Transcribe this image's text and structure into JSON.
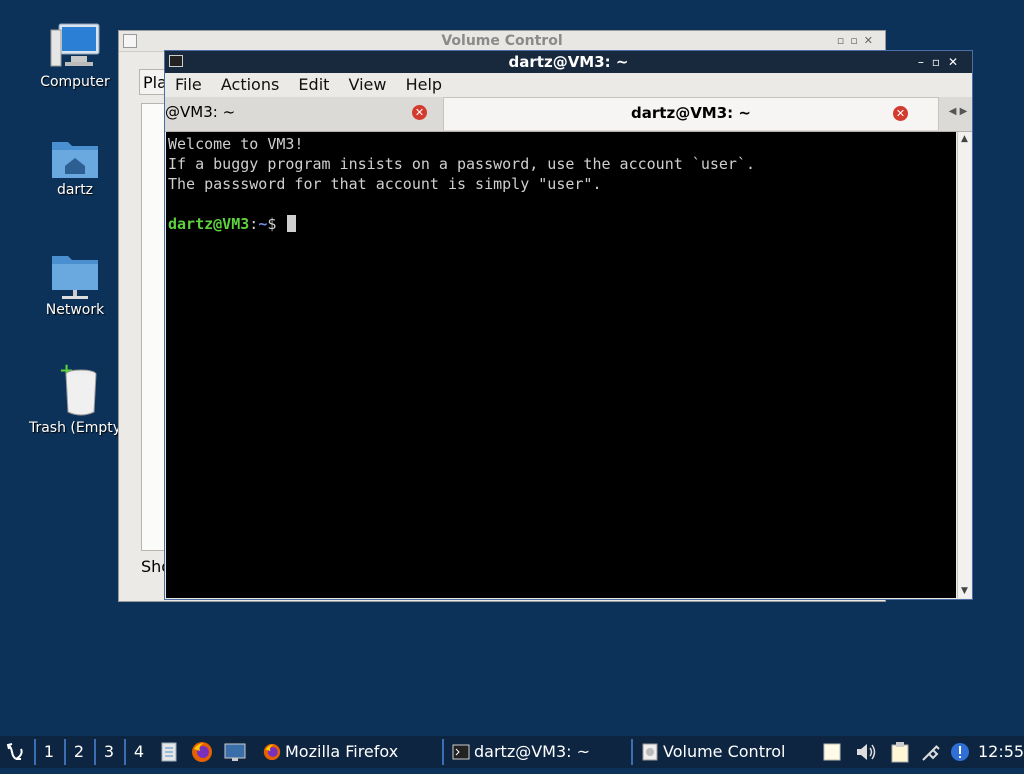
{
  "desktop": {
    "icons": [
      {
        "label": "Computer",
        "icon": "computer-icon"
      },
      {
        "label": "dartz",
        "icon": "home-folder-icon"
      },
      {
        "label": "Network",
        "icon": "network-folder-icon"
      },
      {
        "label": "Trash (Empty",
        "icon": "trash-icon"
      }
    ]
  },
  "volume_window": {
    "title": "Volume Control",
    "menu_partial": "Pla",
    "show_partial": "Sho"
  },
  "terminal": {
    "title": "dartz@VM3: ~",
    "menu": [
      "File",
      "Actions",
      "Edit",
      "View",
      "Help"
    ],
    "tabs": [
      {
        "label": "@VM3: ~",
        "active": false
      },
      {
        "label": "dartz@VM3: ~",
        "active": true
      }
    ],
    "lines": [
      "Welcome to VM3!",
      "If a buggy program insists on a password, use the account `user`.",
      "The passsword for that account is simply \"user\"."
    ],
    "prompt_user": "dartz@VM3",
    "prompt_sep": ":",
    "prompt_path": "~",
    "prompt_symbol": "$"
  },
  "taskbar": {
    "workspaces": [
      "1",
      "2",
      "3",
      "4"
    ],
    "tasks": [
      {
        "label": "Mozilla Firefox",
        "icon": "firefox-icon"
      },
      {
        "label": "dartz@VM3: ~",
        "icon": "terminal-icon"
      },
      {
        "label": "Volume Control",
        "icon": "volume-control-icon"
      }
    ],
    "clock": "12:55"
  },
  "colors": {
    "desktop_bg": "#0d3259",
    "terminal_bg": "#000000",
    "prompt_user": "#5ed13e",
    "prompt_path": "#6d8fe0",
    "taskbar_bg": "#0e2541"
  }
}
